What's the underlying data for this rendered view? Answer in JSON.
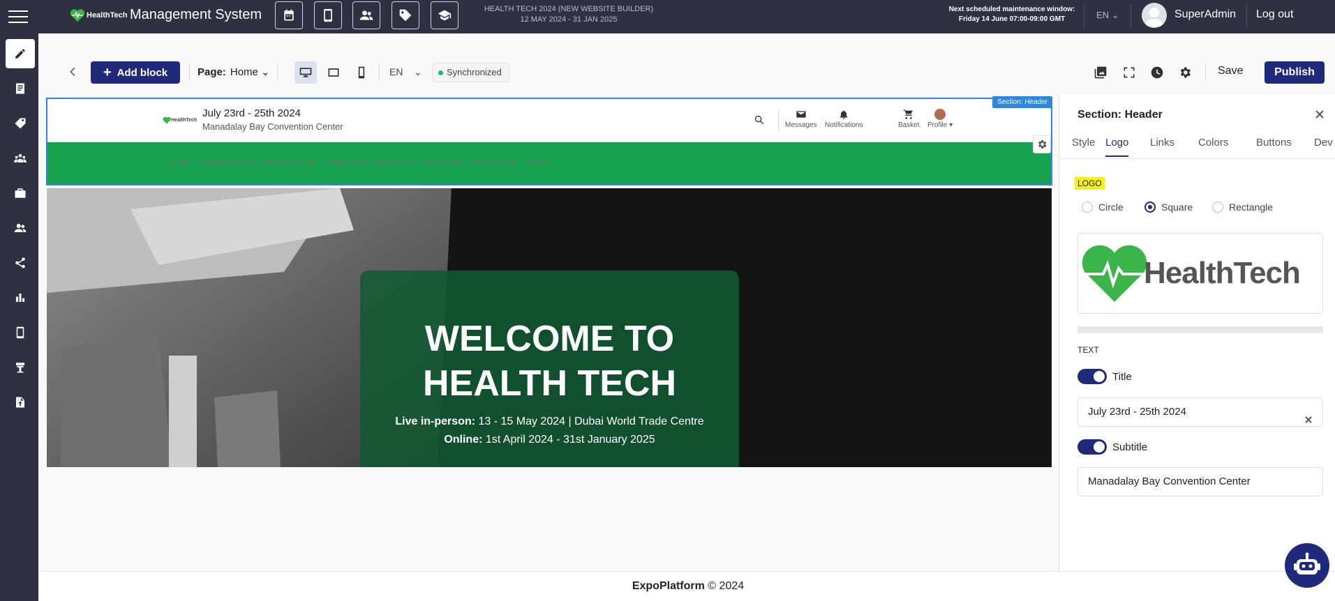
{
  "topbar": {
    "logo_text": "HealthTech",
    "app_title": "Management System",
    "quick_icons": [
      "calendar-icon",
      "mobile-icon",
      "people-icon",
      "tag-icon",
      "graduation-cap-icon"
    ],
    "event_name": "HEALTH TECH 2024 (NEW WEBSITE BUILDER)",
    "event_dates": "12 MAY 2024 - 31 JAN 2025",
    "maintenance_line1": "Next scheduled maintenance window:",
    "maintenance_line2": "Friday 14 June 07:00-09:00 GMT",
    "language": "EN",
    "user": "SuperAdmin",
    "logout": "Log out"
  },
  "sidebar": {
    "items": [
      "pencil-icon",
      "document-icon",
      "tag-icon",
      "network-icon",
      "briefcase-icon",
      "users-icon",
      "share-icon",
      "bar-chart-icon",
      "mobile-icon",
      "booth-icon",
      "file-upload-icon"
    ],
    "active_index": 0
  },
  "toolbar": {
    "add_block": "Add block",
    "page_label": "Page:",
    "page_value": "Home",
    "language": "EN",
    "sync_status": "Synchronized",
    "save": "Save",
    "publish": "Publish"
  },
  "preview": {
    "section_tag": "Section: Header",
    "logo_text": "HealthTech",
    "title": "July 23rd - 25th 2024",
    "subtitle": "Manadalay Bay Convention Center",
    "nav_items": [
      "Messages",
      "Notifications",
      "Basket",
      "Profile ▾"
    ],
    "menu": [
      "HOME",
      "CONFERENCES",
      "PRESS CENTRE",
      "EXHIBITORS & PRODUCTS",
      "DELEGATES",
      "FLOOR PLAN",
      "NEWS"
    ],
    "hero_line1": "WELCOME TO",
    "hero_line2": "HEALTH TECH",
    "live_label": "Live in-person:",
    "live_text": " 13  - 15 May 2024 | Dubai World Trade Centre",
    "online_label": "Online:",
    "online_text": " 1st April 2024 - 31st January 2025"
  },
  "footer": {
    "brand": "ExpoPlatform",
    "copyright": " © 2024"
  },
  "panel": {
    "title": "Section: Header",
    "tabs": [
      "Style",
      "Logo",
      "Links",
      "Colors",
      "Buttons",
      "Dev"
    ],
    "active_tab": "Logo",
    "logo_section": "LOGO",
    "shape_options": [
      "Circle",
      "Square",
      "Rectangle"
    ],
    "selected_shape": "Square",
    "logo_preview_text": "HealthTech",
    "text_section": "TEXT",
    "title_toggle_label": "Title",
    "title_value": "July 23rd - 25th 2024",
    "subtitle_toggle_label": "Subtitle",
    "subtitle_value": "Manadalay Bay Convention Center"
  },
  "colors": {
    "chrome": "#2d3142",
    "primary": "#1f2a7a",
    "brand_green": "#17a150",
    "selection": "#2e86de"
  }
}
